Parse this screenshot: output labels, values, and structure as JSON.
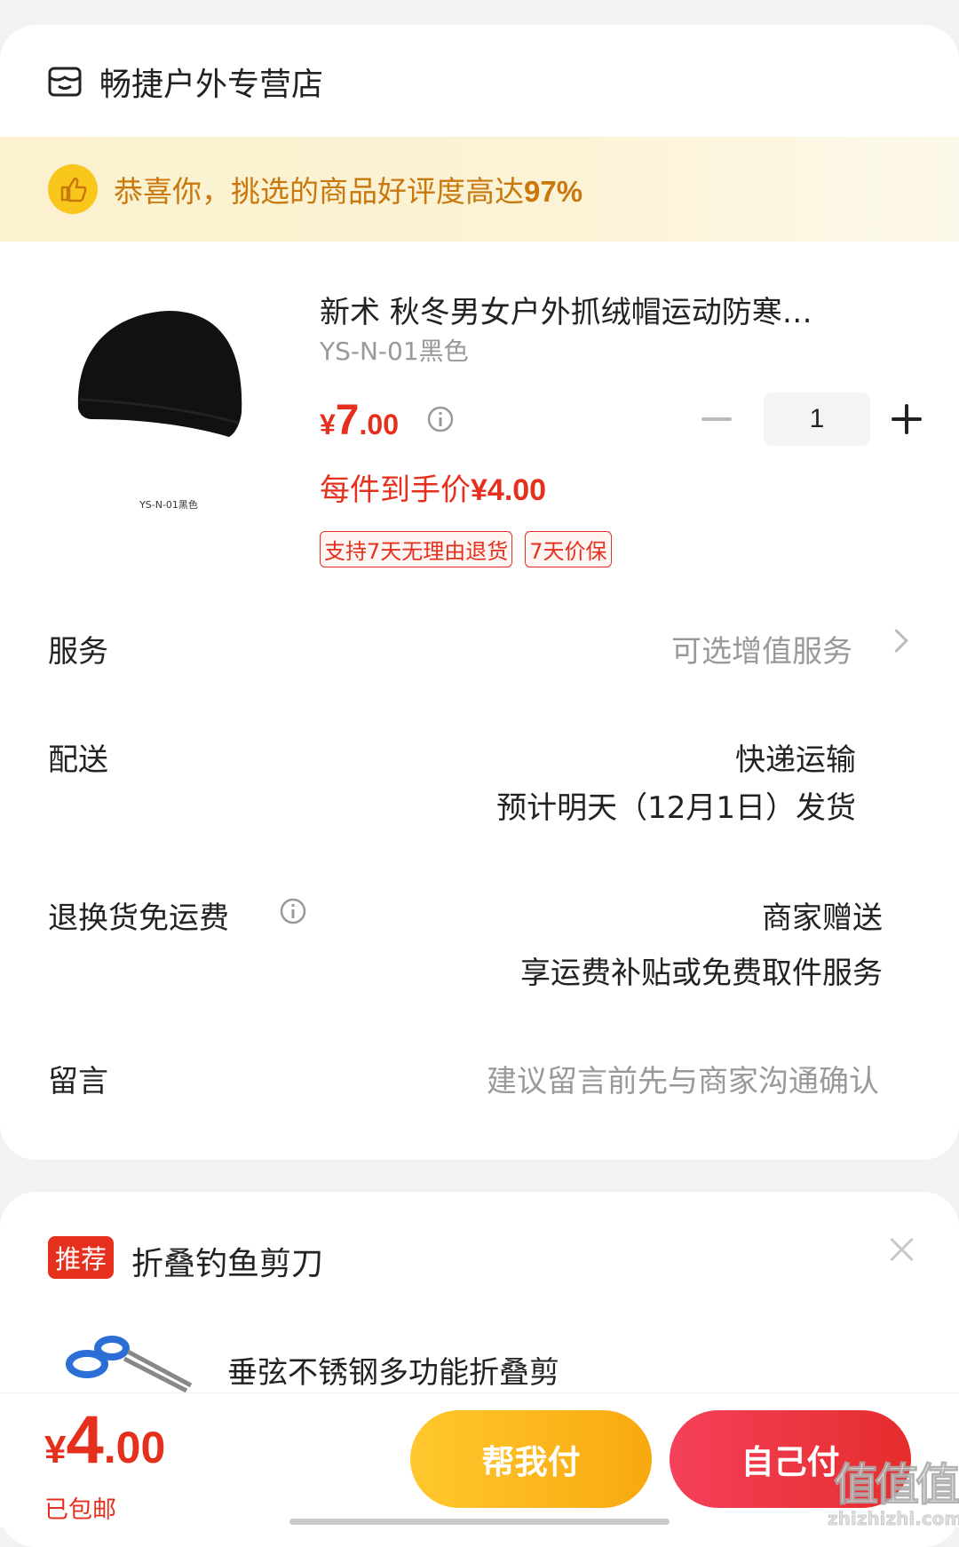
{
  "store": {
    "name": "畅捷户外专营店",
    "icon": "store-icon"
  },
  "banner": {
    "text_prefix": "恭喜你，挑选的商品好评度高达",
    "rate": "97%",
    "icon": "thumbs-up-icon"
  },
  "product": {
    "title": "新术 秋冬男女户外抓绒帽运动防寒…",
    "spec": "YS-N-01黑色",
    "image_caption": "YS-N-01黑色",
    "price": {
      "currency": "¥",
      "integer": "7",
      "decimal": ".00"
    },
    "quantity": "1",
    "per_item_label": "每件到手价",
    "per_item_price": "¥4.00",
    "tags": [
      "支持7天无理由退货",
      "7天价保"
    ]
  },
  "rows": {
    "service": {
      "label": "服务",
      "value": "可选增值服务"
    },
    "delivery": {
      "label": "配送",
      "line1": "快递运输",
      "line2": "预计明天（12月1日）发货"
    },
    "return": {
      "label": "退换货免运费",
      "line1": "商家赠送",
      "line2": "享运费补贴或免费取件服务"
    },
    "message": {
      "label": "留言",
      "placeholder": "建议留言前先与商家沟通确认"
    }
  },
  "recommend": {
    "badge": "推荐",
    "title": "折叠钓鱼剪刀",
    "item_name": "垂弦不锈钢多功能折叠剪"
  },
  "footer": {
    "total": {
      "currency": "¥",
      "integer": "4",
      "decimal": ".00"
    },
    "shipping_note": "已包邮",
    "help_pay": "帮我付",
    "self_pay": "自己付"
  },
  "watermark": {
    "cn": "值值值",
    "en": "zhizhizhi.com"
  },
  "colors": {
    "accent": "#e5301d",
    "banner_text": "#c8780c",
    "help_button": "#f8a90f",
    "self_button": "#e52d2d"
  }
}
